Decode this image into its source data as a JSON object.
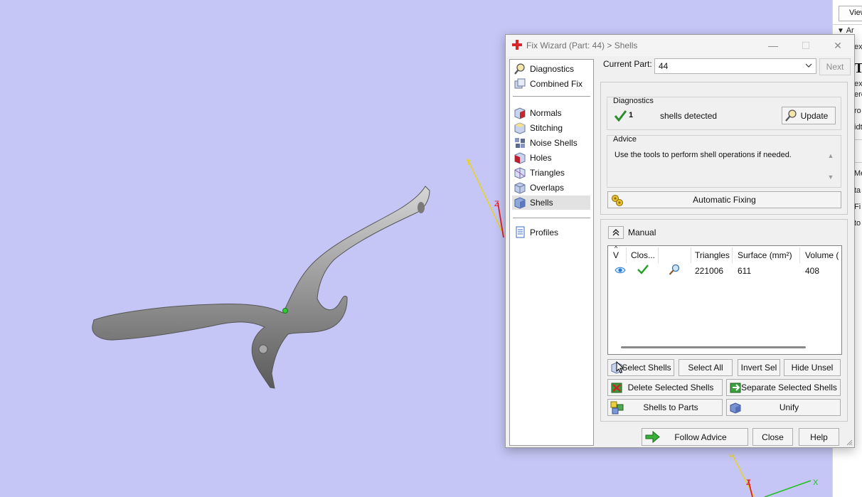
{
  "dialog": {
    "title": "Fix Wizard (Part: 44) > Shells",
    "minimize_glyph": "—",
    "maximize_glyph": "☐",
    "close_glyph": "✕"
  },
  "nav": {
    "items": [
      {
        "label": "Diagnostics",
        "icon": "magnifier-icon"
      },
      {
        "label": "Combined Fix",
        "icon": "combined-fix-icon"
      },
      {
        "label": "Normals",
        "icon": "normals-cube-icon"
      },
      {
        "label": "Stitching",
        "icon": "stitching-cube-icon"
      },
      {
        "label": "Noise Shells",
        "icon": "noise-shells-icon"
      },
      {
        "label": "Holes",
        "icon": "holes-cube-icon"
      },
      {
        "label": "Triangles",
        "icon": "triangles-cube-icon"
      },
      {
        "label": "Overlaps",
        "icon": "overlaps-cube-icon"
      },
      {
        "label": "Shells",
        "icon": "shells-cube-icon",
        "selected": true
      },
      {
        "label": "Profiles",
        "icon": "profiles-document-icon"
      }
    ]
  },
  "current_part": {
    "label": "Current Part:",
    "value": "44"
  },
  "next_label": "Next",
  "diagnostics": {
    "title": "Diagnostics",
    "count": "1",
    "text": "shells detected",
    "update_label": "Update",
    "status_color": "#2e8b2e"
  },
  "advice": {
    "title": "Advice",
    "text": "Use the tools to perform shell operations if needed."
  },
  "automatic_fixing_label": "Automatic Fixing",
  "manual": {
    "title": "Manual",
    "collapse_glyph": "^",
    "columns": [
      "V",
      "Clos...",
      "",
      "Triangles",
      "Surface (mm²)",
      "Volume ("
    ],
    "rows": [
      {
        "triangles": "221006",
        "surface": "611",
        "volume": "408"
      }
    ],
    "buttons": {
      "select_shells": "Select Shells",
      "select_all": "Select All",
      "invert_sel": "Invert Sel",
      "hide_unsel": "Hide Unsel",
      "delete_selected": "Delete Selected Shells",
      "separate_selected": "Separate Selected Shells",
      "shells_to_parts": "Shells to Parts",
      "unify": "Unify"
    }
  },
  "footer": {
    "follow_advice": "Follow Advice",
    "close": "Close",
    "help": "Help"
  },
  "side_strip": {
    "view_label": "View",
    "rows": [
      "Ar",
      "ext",
      "ext",
      "ero",
      "ro",
      "idt",
      "Me",
      "ta",
      "Fi",
      "to"
    ],
    "big_letter": "T"
  },
  "viewport": {
    "background": "#c6c6f6",
    "axis_labels": [
      "Y",
      "Z",
      "Y",
      "Z",
      "X"
    ]
  }
}
